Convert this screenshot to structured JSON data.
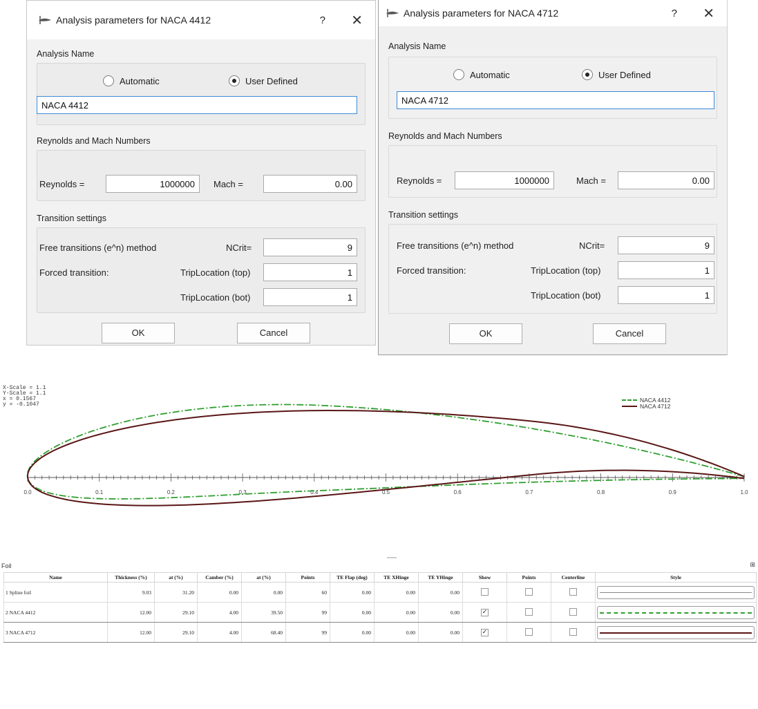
{
  "dialogs": [
    {
      "title": "Analysis parameters for NACA 4412",
      "help": "?",
      "close": "✕",
      "analysis_name_label": "Analysis Name",
      "radio_automatic": "Automatic",
      "radio_user_defined": "User Defined",
      "selected_radio": "User Defined",
      "name_value": "NACA 4412",
      "reynolds_section": "Reynolds and Mach Numbers",
      "reynolds_label": "Reynolds =",
      "reynolds_value": "1000000",
      "mach_label": "Mach =",
      "mach_value": "0.00",
      "transition_section": "Transition settings",
      "free_transition_label": "Free transitions (e^n) method",
      "ncrit_label": "NCrit=",
      "ncrit_value": "9",
      "forced_label": "Forced transition:",
      "trip_top_label": "TripLocation (top)",
      "trip_top_value": "1",
      "trip_bot_label": "TripLocation (bot)",
      "trip_bot_value": "1",
      "ok": "OK",
      "cancel": "Cancel"
    },
    {
      "title": "Analysis parameters for NACA 4712",
      "help": "?",
      "close": "✕",
      "analysis_name_label": "Analysis Name",
      "radio_automatic": "Automatic",
      "radio_user_defined": "User Defined",
      "selected_radio": "User Defined",
      "name_value": "NACA 4712",
      "reynolds_section": "Reynolds and Mach Numbers",
      "reynolds_label": "Reynolds =",
      "reynolds_value": "1000000",
      "mach_label": "Mach =",
      "mach_value": "0.00",
      "transition_section": "Transition settings",
      "free_transition_label": "Free transitions (e^n) method",
      "ncrit_label": "NCrit=",
      "ncrit_value": "9",
      "forced_label": "Forced transition:",
      "trip_top_label": "TripLocation (top)",
      "trip_top_value": "1",
      "trip_bot_label": "TripLocation (bot)",
      "trip_bot_value": "1",
      "ok": "OK",
      "cancel": "Cancel"
    }
  ],
  "plot": {
    "readout": [
      "X-Scale = 1.1",
      "Y-Scale = 1.1",
      "x = 0.1567",
      "y = -0.1047"
    ]
  },
  "chart_data": {
    "type": "line",
    "x_ticks": [
      "0.0",
      "0.1",
      "0.2",
      "0.3",
      "0.4",
      "0.5",
      "0.6",
      "0.7",
      "0.8",
      "0.9",
      "1.0"
    ],
    "xlim": [
      0,
      1
    ],
    "grid": false,
    "legend_position": "top-right",
    "series": [
      {
        "name": "NACA 4412",
        "color": "#2e9e2e",
        "style": "dash-dot",
        "max_camber": 0.04,
        "camber_position": 0.4,
        "thickness": 0.12
      },
      {
        "name": "NACA 4712",
        "color": "#5a1515",
        "style": "solid",
        "max_camber": 0.04,
        "camber_position": 0.7,
        "thickness": 0.12
      }
    ]
  },
  "table": {
    "title": "Foil",
    "corner": "⊞",
    "headers": [
      "Name",
      "Thickness (%)",
      "at (%)",
      "Camber (%)",
      "at (%)",
      "Points",
      "TE Flap (deg)",
      "TE XHinge",
      "TE YHinge",
      "Show",
      "Points",
      "Centerline",
      "Style"
    ],
    "rows": [
      {
        "num": "1",
        "name": "Spline foil",
        "thickness": "9.03",
        "at1": "31.20",
        "camber": "0.00",
        "at2": "0.00",
        "points": "60",
        "flap": "0.00",
        "xhinge": "0.00",
        "yhinge": "0.00",
        "show": false,
        "pts": false,
        "center": false,
        "style_color": "#888888",
        "style": "solid"
      },
      {
        "num": "2",
        "name": "NACA 4412",
        "thickness": "12.00",
        "at1": "29.10",
        "camber": "4.00",
        "at2": "39.50",
        "points": "99",
        "flap": "0.00",
        "xhinge": "0.00",
        "yhinge": "0.00",
        "show": true,
        "pts": false,
        "center": false,
        "style_color": "#2e9e2e",
        "style": "dash-dot"
      },
      {
        "num": "3",
        "name": "NACA 4712",
        "thickness": "12.00",
        "at1": "29.10",
        "camber": "4.00",
        "at2": "68.40",
        "points": "99",
        "flap": "0.00",
        "xhinge": "0.00",
        "yhinge": "0.00",
        "show": true,
        "pts": false,
        "center": false,
        "style_color": "#5a1515",
        "style": "solid"
      }
    ]
  }
}
